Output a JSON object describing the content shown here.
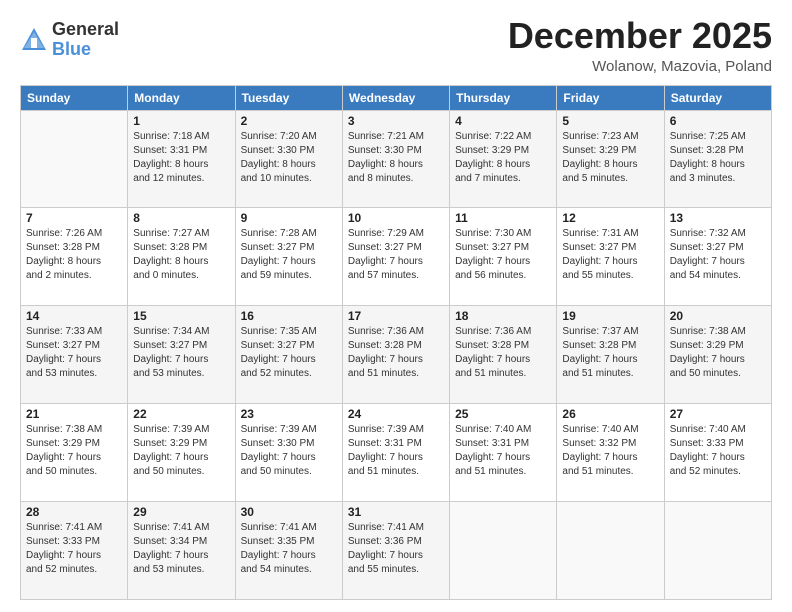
{
  "logo": {
    "general": "General",
    "blue": "Blue"
  },
  "title": "December 2025",
  "location": "Wolanow, Mazovia, Poland",
  "days_header": [
    "Sunday",
    "Monday",
    "Tuesday",
    "Wednesday",
    "Thursday",
    "Friday",
    "Saturday"
  ],
  "weeks": [
    [
      {
        "day": "",
        "info": ""
      },
      {
        "day": "1",
        "info": "Sunrise: 7:18 AM\nSunset: 3:31 PM\nDaylight: 8 hours\nand 12 minutes."
      },
      {
        "day": "2",
        "info": "Sunrise: 7:20 AM\nSunset: 3:30 PM\nDaylight: 8 hours\nand 10 minutes."
      },
      {
        "day": "3",
        "info": "Sunrise: 7:21 AM\nSunset: 3:30 PM\nDaylight: 8 hours\nand 8 minutes."
      },
      {
        "day": "4",
        "info": "Sunrise: 7:22 AM\nSunset: 3:29 PM\nDaylight: 8 hours\nand 7 minutes."
      },
      {
        "day": "5",
        "info": "Sunrise: 7:23 AM\nSunset: 3:29 PM\nDaylight: 8 hours\nand 5 minutes."
      },
      {
        "day": "6",
        "info": "Sunrise: 7:25 AM\nSunset: 3:28 PM\nDaylight: 8 hours\nand 3 minutes."
      }
    ],
    [
      {
        "day": "7",
        "info": "Sunrise: 7:26 AM\nSunset: 3:28 PM\nDaylight: 8 hours\nand 2 minutes."
      },
      {
        "day": "8",
        "info": "Sunrise: 7:27 AM\nSunset: 3:28 PM\nDaylight: 8 hours\nand 0 minutes."
      },
      {
        "day": "9",
        "info": "Sunrise: 7:28 AM\nSunset: 3:27 PM\nDaylight: 7 hours\nand 59 minutes."
      },
      {
        "day": "10",
        "info": "Sunrise: 7:29 AM\nSunset: 3:27 PM\nDaylight: 7 hours\nand 57 minutes."
      },
      {
        "day": "11",
        "info": "Sunrise: 7:30 AM\nSunset: 3:27 PM\nDaylight: 7 hours\nand 56 minutes."
      },
      {
        "day": "12",
        "info": "Sunrise: 7:31 AM\nSunset: 3:27 PM\nDaylight: 7 hours\nand 55 minutes."
      },
      {
        "day": "13",
        "info": "Sunrise: 7:32 AM\nSunset: 3:27 PM\nDaylight: 7 hours\nand 54 minutes."
      }
    ],
    [
      {
        "day": "14",
        "info": "Sunrise: 7:33 AM\nSunset: 3:27 PM\nDaylight: 7 hours\nand 53 minutes."
      },
      {
        "day": "15",
        "info": "Sunrise: 7:34 AM\nSunset: 3:27 PM\nDaylight: 7 hours\nand 53 minutes."
      },
      {
        "day": "16",
        "info": "Sunrise: 7:35 AM\nSunset: 3:27 PM\nDaylight: 7 hours\nand 52 minutes."
      },
      {
        "day": "17",
        "info": "Sunrise: 7:36 AM\nSunset: 3:28 PM\nDaylight: 7 hours\nand 51 minutes."
      },
      {
        "day": "18",
        "info": "Sunrise: 7:36 AM\nSunset: 3:28 PM\nDaylight: 7 hours\nand 51 minutes."
      },
      {
        "day": "19",
        "info": "Sunrise: 7:37 AM\nSunset: 3:28 PM\nDaylight: 7 hours\nand 51 minutes."
      },
      {
        "day": "20",
        "info": "Sunrise: 7:38 AM\nSunset: 3:29 PM\nDaylight: 7 hours\nand 50 minutes."
      }
    ],
    [
      {
        "day": "21",
        "info": "Sunrise: 7:38 AM\nSunset: 3:29 PM\nDaylight: 7 hours\nand 50 minutes."
      },
      {
        "day": "22",
        "info": "Sunrise: 7:39 AM\nSunset: 3:29 PM\nDaylight: 7 hours\nand 50 minutes."
      },
      {
        "day": "23",
        "info": "Sunrise: 7:39 AM\nSunset: 3:30 PM\nDaylight: 7 hours\nand 50 minutes."
      },
      {
        "day": "24",
        "info": "Sunrise: 7:39 AM\nSunset: 3:31 PM\nDaylight: 7 hours\nand 51 minutes."
      },
      {
        "day": "25",
        "info": "Sunrise: 7:40 AM\nSunset: 3:31 PM\nDaylight: 7 hours\nand 51 minutes."
      },
      {
        "day": "26",
        "info": "Sunrise: 7:40 AM\nSunset: 3:32 PM\nDaylight: 7 hours\nand 51 minutes."
      },
      {
        "day": "27",
        "info": "Sunrise: 7:40 AM\nSunset: 3:33 PM\nDaylight: 7 hours\nand 52 minutes."
      }
    ],
    [
      {
        "day": "28",
        "info": "Sunrise: 7:41 AM\nSunset: 3:33 PM\nDaylight: 7 hours\nand 52 minutes."
      },
      {
        "day": "29",
        "info": "Sunrise: 7:41 AM\nSunset: 3:34 PM\nDaylight: 7 hours\nand 53 minutes."
      },
      {
        "day": "30",
        "info": "Sunrise: 7:41 AM\nSunset: 3:35 PM\nDaylight: 7 hours\nand 54 minutes."
      },
      {
        "day": "31",
        "info": "Sunrise: 7:41 AM\nSunset: 3:36 PM\nDaylight: 7 hours\nand 55 minutes."
      },
      {
        "day": "",
        "info": ""
      },
      {
        "day": "",
        "info": ""
      },
      {
        "day": "",
        "info": ""
      }
    ]
  ]
}
